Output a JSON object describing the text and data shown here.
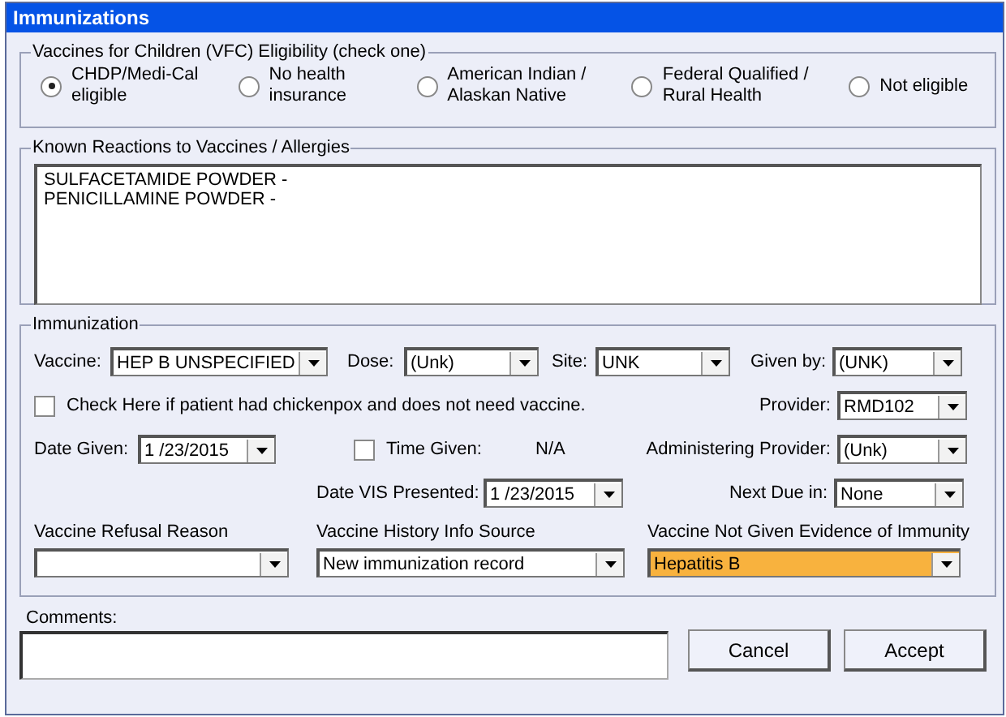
{
  "window": {
    "title": "Immunizations"
  },
  "vfc": {
    "legend": "Vaccines for Children (VFC) Eligibility (check one)",
    "options": [
      {
        "label": "CHDP/Medi-Cal eligible",
        "selected": true
      },
      {
        "label": "No health insurance",
        "selected": false
      },
      {
        "label": "American Indian / Alaskan Native",
        "selected": false
      },
      {
        "label": "Federal Qualified / Rural Health",
        "selected": false
      },
      {
        "label": "Not eligible",
        "selected": false
      }
    ]
  },
  "reactions": {
    "legend": "Known Reactions to Vaccines / Allergies",
    "lines": [
      "SULFACETAMIDE POWDER -",
      "PENICILLAMINE POWDER -"
    ]
  },
  "immunization": {
    "legend": "Immunization",
    "vaccine": {
      "label": "Vaccine:",
      "value": "HEP B UNSPECIFIED"
    },
    "dose": {
      "label": "Dose:",
      "value": "(Unk)"
    },
    "site": {
      "label": "Site:",
      "value": "UNK"
    },
    "given_by": {
      "label": "Given by:",
      "value": "(UNK)"
    },
    "chickenpox": {
      "label": "Check Here if patient had chickenpox and does not need vaccine.",
      "checked": false
    },
    "provider": {
      "label": "Provider:",
      "value": "RMD102"
    },
    "date_given": {
      "label": "Date Given:",
      "value": "1 /23/2015"
    },
    "time_given": {
      "label": "Time Given:",
      "checked": false,
      "value": "N/A"
    },
    "administering_provider": {
      "label": "Administering Provider:",
      "value": "(Unk)"
    },
    "date_vis": {
      "label": "Date VIS Presented:",
      "value": "1 /23/2015"
    },
    "next_due": {
      "label": "Next Due in:",
      "value": "None"
    },
    "refusal_reason": {
      "label": "Vaccine Refusal Reason"
    },
    "history_source": {
      "label": "Vaccine History Info Source",
      "value": "New immunization record"
    },
    "not_given_evidence": {
      "label": "Vaccine Not Given Evidence of Immunity",
      "value": "Hepatitis B",
      "highlighted": true
    }
  },
  "comments": {
    "label": "Comments:"
  },
  "buttons": [
    "Cancel",
    "Accept"
  ]
}
